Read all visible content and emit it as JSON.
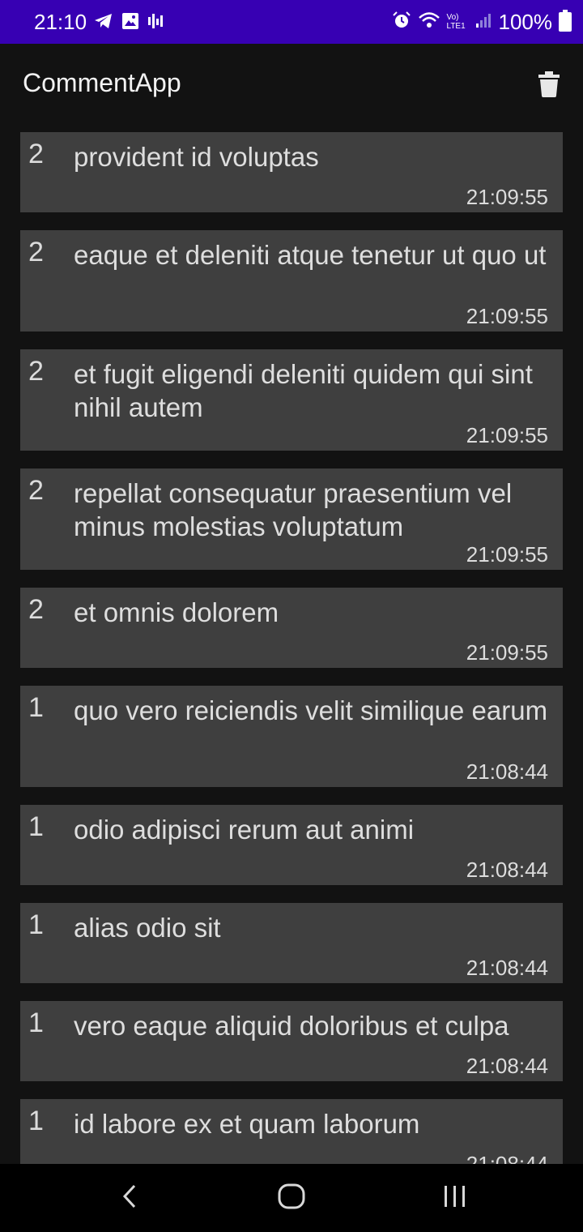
{
  "status_bar": {
    "time": "21:10",
    "battery_text": "100%",
    "left_icons": [
      "telegram-icon",
      "gallery-icon",
      "voice-icon"
    ],
    "right_icons": [
      "alarm-icon",
      "wifi-icon",
      "volte-icon",
      "signal-icon",
      "battery-icon"
    ],
    "volte_label": "Vo) LTE1"
  },
  "app_bar": {
    "title": "CommentApp",
    "delete_icon": "trash-icon"
  },
  "comments": [
    {
      "num": "2",
      "text": "provident id voluptas",
      "time": "21:09:55"
    },
    {
      "num": "2",
      "text": "eaque et deleniti atque tenetur ut quo ut",
      "time": "21:09:55"
    },
    {
      "num": "2",
      "text": "et fugit eligendi deleniti quidem qui sint nihil autem",
      "time": "21:09:55"
    },
    {
      "num": "2",
      "text": "repellat consequatur praesentium vel minus molestias voluptatum",
      "time": "21:09:55"
    },
    {
      "num": "2",
      "text": "et omnis dolorem",
      "time": "21:09:55"
    },
    {
      "num": "1",
      "text": "quo vero reiciendis velit similique earum",
      "time": "21:08:44"
    },
    {
      "num": "1",
      "text": "odio adipisci rerum aut animi",
      "time": "21:08:44"
    },
    {
      "num": "1",
      "text": "alias odio sit",
      "time": "21:08:44"
    },
    {
      "num": "1",
      "text": "vero eaque aliquid doloribus et culpa",
      "time": "21:08:44"
    },
    {
      "num": "1",
      "text": "id labore ex et quam laborum",
      "time": "21:08:44"
    }
  ],
  "nav_bar": {
    "back_icon": "back-icon",
    "home_icon": "home-icon",
    "recents_icon": "recents-icon"
  },
  "colors": {
    "status_bar": "#3700b3",
    "background": "#121212",
    "card": "#3f3f3f"
  }
}
